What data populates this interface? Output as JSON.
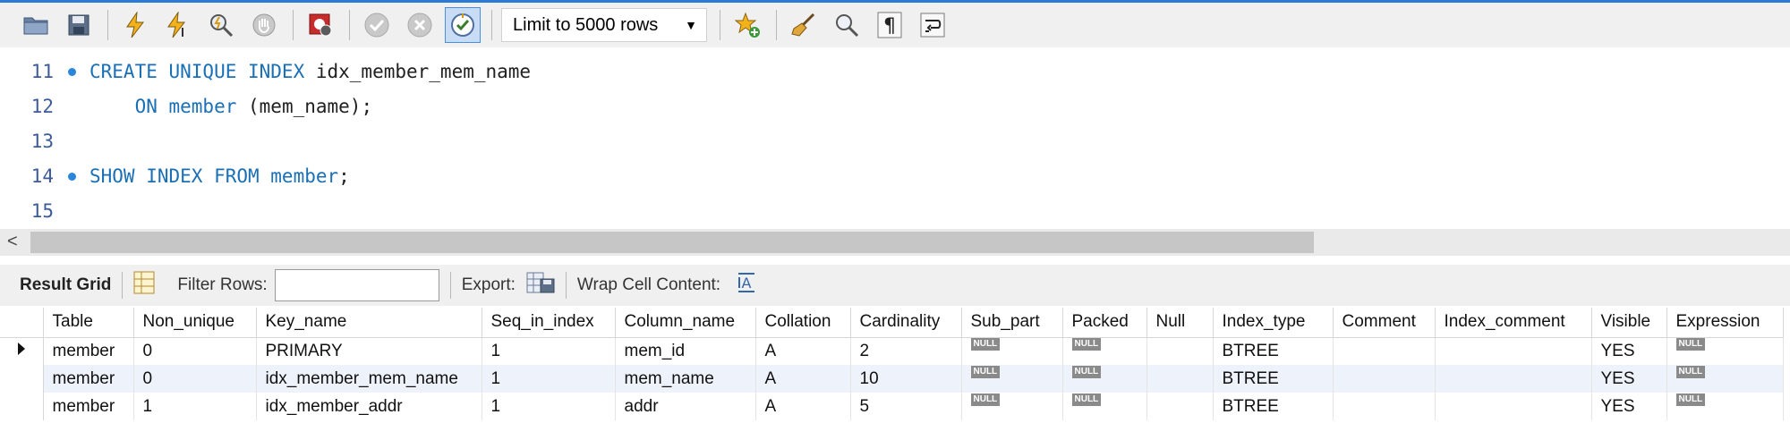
{
  "toolbar": {
    "buttons": [
      {
        "name": "open-folder-icon",
        "icon": "folder"
      },
      {
        "name": "save-icon",
        "icon": "floppy"
      },
      {
        "name": "execute-icon",
        "icon": "lightning"
      },
      {
        "name": "execute-current-icon",
        "icon": "lightning-cursor"
      },
      {
        "name": "explain-icon",
        "icon": "magnifier-lightning"
      },
      {
        "name": "stop-icon",
        "icon": "hand"
      },
      {
        "name": "toggle-error-icon",
        "icon": "stop-error"
      },
      {
        "name": "commit-icon",
        "icon": "check"
      },
      {
        "name": "rollback-icon",
        "icon": "cross"
      },
      {
        "name": "autocommit-icon",
        "icon": "autocommit",
        "active": true
      }
    ],
    "limit_select": "Limit to 5000 rows",
    "right_buttons": [
      {
        "name": "add-snippet-icon",
        "icon": "star"
      },
      {
        "name": "beautify-icon",
        "icon": "broom"
      },
      {
        "name": "find-icon",
        "icon": "magnifier"
      },
      {
        "name": "invisible-chars-icon",
        "icon": "pilcrow"
      },
      {
        "name": "wrap-lines-icon",
        "icon": "wrap"
      }
    ]
  },
  "editor": {
    "lines": [
      {
        "num": "11",
        "dot": true,
        "tokens": [
          {
            "t": "CREATE UNIQUE INDEX",
            "k": true
          },
          {
            "t": " idx_member_mem_name",
            "k": false
          }
        ]
      },
      {
        "num": "12",
        "dot": false,
        "tokens": [
          {
            "t": "    ON member",
            "k": true
          },
          {
            "t": " (mem_name);",
            "k": false
          }
        ]
      },
      {
        "num": "13",
        "dot": false,
        "tokens": []
      },
      {
        "num": "14",
        "dot": true,
        "tokens": [
          {
            "t": "SHOW INDEX FROM member",
            "k": true
          },
          {
            "t": ";",
            "k": false
          }
        ]
      },
      {
        "num": "15",
        "dot": false,
        "tokens": []
      }
    ]
  },
  "result_bar": {
    "result_grid": "Result Grid",
    "filter_rows": "Filter Rows:",
    "export": "Export:",
    "wrap_cell": "Wrap Cell Content:"
  },
  "grid": {
    "columns": [
      "Table",
      "Non_unique",
      "Key_name",
      "Seq_in_index",
      "Column_name",
      "Collation",
      "Cardinality",
      "Sub_part",
      "Packed",
      "Null",
      "Index_type",
      "Comment",
      "Index_comment",
      "Visible",
      "Expression"
    ],
    "rows": [
      [
        "member",
        "0",
        "PRIMARY",
        "1",
        "mem_id",
        "A",
        "2",
        "NULL",
        "NULL",
        "",
        "BTREE",
        "",
        "",
        "YES",
        "NULL"
      ],
      [
        "member",
        "0",
        "idx_member_mem_name",
        "1",
        "mem_name",
        "A",
        "10",
        "NULL",
        "NULL",
        "",
        "BTREE",
        "",
        "",
        "YES",
        "NULL"
      ],
      [
        "member",
        "1",
        "idx_member_addr",
        "1",
        "addr",
        "A",
        "5",
        "NULL",
        "NULL",
        "",
        "BTREE",
        "",
        "",
        "YES",
        "NULL"
      ]
    ],
    "current_row": 0
  }
}
